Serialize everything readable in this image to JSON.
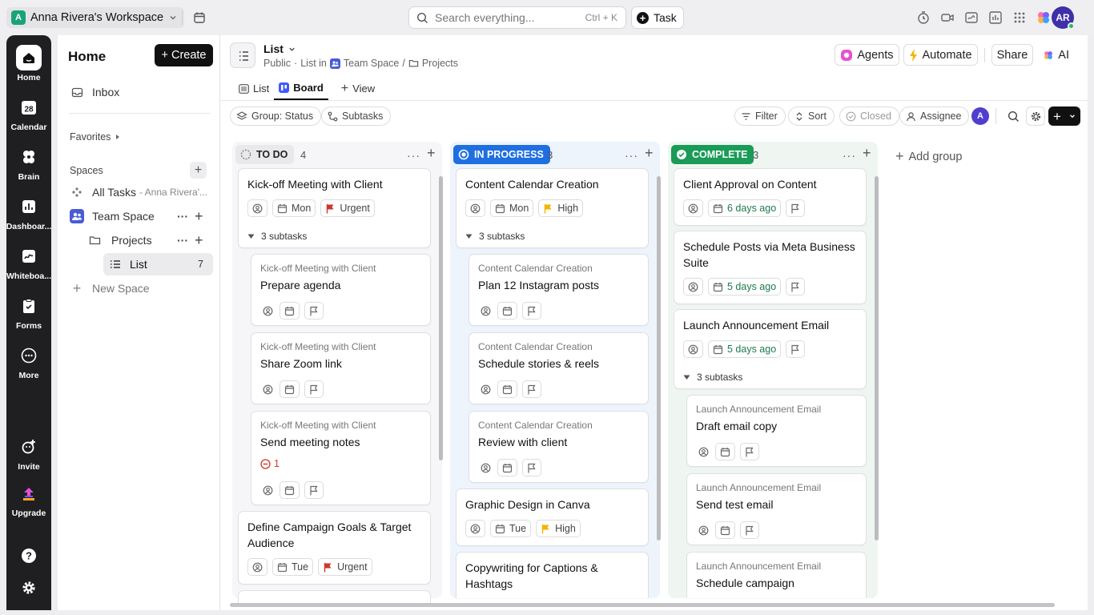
{
  "workspace": {
    "name": "Anna Rivera's Workspace",
    "initial": "A"
  },
  "search": {
    "placeholder": "Search everything...",
    "shortcut": "Ctrl + K"
  },
  "new_task_label": "Task",
  "user": {
    "initials": "AR"
  },
  "rail": [
    {
      "label": "Home",
      "icon": "home-icon"
    },
    {
      "label": "Calendar",
      "icon": "calendar-icon",
      "badge": "28"
    },
    {
      "label": "Brain",
      "icon": "brain-icon"
    },
    {
      "label": "Dashboar...",
      "icon": "dashboard-icon"
    },
    {
      "label": "Whiteboa...",
      "icon": "whiteboard-icon"
    },
    {
      "label": "Forms",
      "icon": "forms-icon"
    },
    {
      "label": "More",
      "icon": "more-icon"
    },
    {
      "label": "Invite",
      "icon": "invite-icon"
    },
    {
      "label": "Upgrade",
      "icon": "upgrade-icon"
    }
  ],
  "sidebar": {
    "title": "Home",
    "create_label": "Create",
    "inbox": "Inbox",
    "favorites": "Favorites",
    "spaces": "Spaces",
    "all_tasks": "All Tasks",
    "all_tasks_owner": "- Anna Rivera'...",
    "team_space": "Team Space",
    "projects": "Projects",
    "list": "List",
    "list_count": "7",
    "new_space": "New Space"
  },
  "header": {
    "title": "List",
    "crumb_public": "Public",
    "crumb_list_in": "List in",
    "crumb_space": "Team Space",
    "crumb_sep": "/",
    "crumb_folder": "Projects",
    "tabs": [
      "List",
      "Board",
      "View"
    ],
    "agents": "Agents",
    "automate": "Automate",
    "share": "Share",
    "ai": "AI"
  },
  "toolbar": {
    "group": "Group: Status",
    "subtasks": "Subtasks",
    "filter": "Filter",
    "sort": "Sort",
    "closed": "Closed",
    "assignee": "Assignee",
    "assignee_avatar": "A"
  },
  "columns": {
    "todo": {
      "label": "TO DO",
      "count": "4",
      "color": "#e9e9ec"
    },
    "progress": {
      "label": "IN PROGRESS",
      "count": "3",
      "color": "#1f6fe0"
    },
    "complete": {
      "label": "COMPLETE",
      "count": "3",
      "color": "#1a9b57"
    }
  },
  "cards": {
    "t1": {
      "title": "Kick-off Meeting with Client",
      "date": "Mon",
      "priority": "Urgent",
      "subtasks": "3 subtasks"
    },
    "t1a": {
      "parent": "Kick-off Meeting with Client",
      "title": "Prepare agenda"
    },
    "t1b": {
      "parent": "Kick-off Meeting with Client",
      "title": "Share Zoom link"
    },
    "t1c": {
      "parent": "Kick-off Meeting with Client",
      "title": "Send meeting notes",
      "blocked": "1"
    },
    "t2": {
      "title1": "Define Campaign Goals & Target",
      "title2": "Audience",
      "date": "Tue",
      "priority": "Urgent"
    },
    "p1": {
      "title": "Content Calendar Creation",
      "date": "Mon",
      "priority": "High",
      "subtasks": "3 subtasks"
    },
    "p1a": {
      "parent": "Content Calendar Creation",
      "title": "Plan 12 Instagram posts"
    },
    "p1b": {
      "parent": "Content Calendar Creation",
      "title": "Schedule stories & reels"
    },
    "p1c": {
      "parent": "Content Calendar Creation",
      "title": "Review with client"
    },
    "p2": {
      "title": "Graphic Design in Canva",
      "date": "Tue",
      "priority": "High"
    },
    "p3": {
      "title1": "Copywriting for Captions &",
      "title2": "Hashtags"
    },
    "c1": {
      "title": "Client Approval on Content",
      "date": "6 days ago"
    },
    "c2": {
      "title1": "Schedule Posts via Meta Business",
      "title2": "Suite",
      "date": "5 days ago"
    },
    "c3": {
      "title": "Launch Announcement Email",
      "date": "5 days ago",
      "subtasks": "3 subtasks"
    },
    "c3a": {
      "parent": "Launch Announcement Email",
      "title": "Draft email copy"
    },
    "c3b": {
      "parent": "Launch Announcement Email",
      "title": "Send test email"
    },
    "c3c": {
      "parent": "Launch Announcement Email",
      "title": "Schedule campaign"
    }
  },
  "add_group": "Add group",
  "colors": {
    "urgent": "#d0352b",
    "high": "#f4b400",
    "accent": "#5b4fd6"
  }
}
